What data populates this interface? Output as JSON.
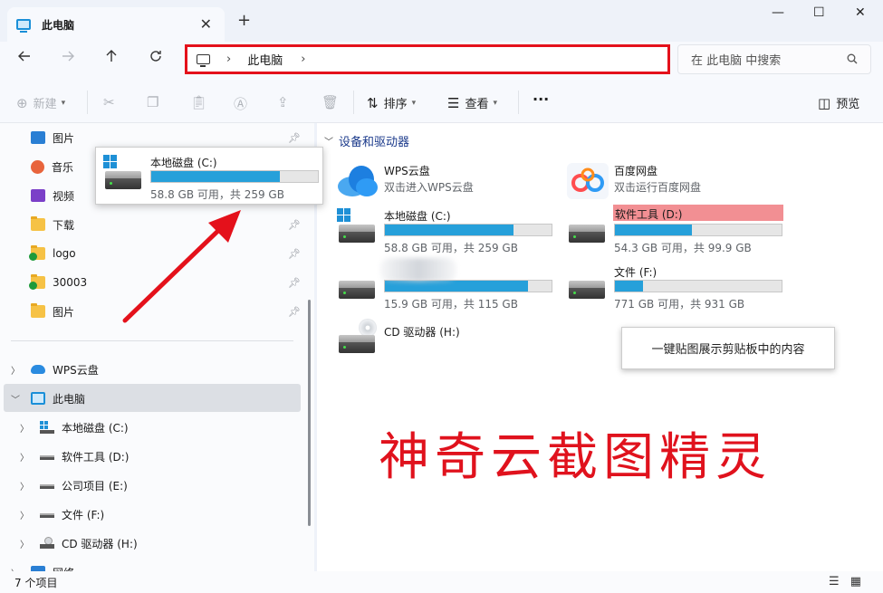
{
  "window": {
    "tab_title": "此电脑",
    "tab_close": "✕",
    "new_tab": "+",
    "minimize": "—",
    "maximize": "☐",
    "close": "✕"
  },
  "nav": {
    "address_crumbs": [
      "此电脑"
    ],
    "search_placeholder": "在 此电脑 中搜索"
  },
  "toolbar": {
    "new_label": "新建",
    "sort_label": "排序",
    "view_label": "查看",
    "more_label": "···",
    "preview_label": "预览"
  },
  "sidebar": {
    "quick": [
      {
        "label": "图片",
        "icon": "pictures-icon",
        "pinned": true
      },
      {
        "label": "音乐",
        "icon": "music-icon",
        "pinned": false
      },
      {
        "label": "视频",
        "icon": "video-icon",
        "pinned": false
      },
      {
        "label": "下载",
        "icon": "folder-icon",
        "pinned": true
      },
      {
        "label": "logo",
        "icon": "folder-check-icon",
        "pinned": true
      },
      {
        "label": "30003",
        "icon": "folder-check-icon",
        "pinned": true
      },
      {
        "label": "图片",
        "icon": "folder-icon",
        "pinned": true
      }
    ],
    "tree": [
      {
        "label": "WPS云盘",
        "icon": "cloud-icon",
        "expanded": false
      },
      {
        "label": "此电脑",
        "icon": "computer-icon",
        "expanded": true
      },
      {
        "label": "本地磁盘 (C:)",
        "icon": "drive-icon",
        "expanded": false
      },
      {
        "label": "软件工具 (D:)",
        "icon": "drive-icon",
        "expanded": false
      },
      {
        "label": "公司项目 (E:)",
        "icon": "drive-icon",
        "expanded": false
      },
      {
        "label": "文件 (F:)",
        "icon": "drive-icon",
        "expanded": false
      },
      {
        "label": "CD 驱动器 (H:)",
        "icon": "cd-icon",
        "expanded": false
      },
      {
        "label": "网络",
        "icon": "network-icon",
        "expanded": false
      }
    ]
  },
  "content": {
    "group_title": "设备和驱动器",
    "apps": [
      {
        "name": "WPS云盘",
        "desc": "双击进入WPS云盘"
      },
      {
        "name": "百度网盘",
        "desc": "双击运行百度网盘"
      }
    ],
    "drives": [
      {
        "name": "本地磁盘 (C:)",
        "info": "58.8 GB 可用，共 259 GB",
        "used": 0.77
      },
      {
        "name": "软件工具 (D:)",
        "info": "54.3 GB 可用，共 99.9 GB",
        "used": 0.46
      },
      {
        "name": "",
        "info": "15.9 GB 可用，共 115 GB",
        "used": 0.86
      },
      {
        "name": "文件 (F:)",
        "info": "771 GB 可用，共 931 GB",
        "used": 0.17
      }
    ],
    "cd_drive": "CD 驱动器 (H:)"
  },
  "popup": {
    "name": "本地磁盘 (C:)",
    "info": "58.8 GB 可用，共 259 GB",
    "used": 0.77
  },
  "tooltip": "一键贴图展示剪贴板中的内容",
  "watermark": "神奇云截图精灵",
  "status": {
    "count": "7 个项目"
  },
  "colors": {
    "address_highlight": "#e4111b",
    "drive_bar": "#26a0da",
    "selected_drive": "#f28f93",
    "watermark": "#e0121d",
    "arrow": "#e4111b"
  }
}
